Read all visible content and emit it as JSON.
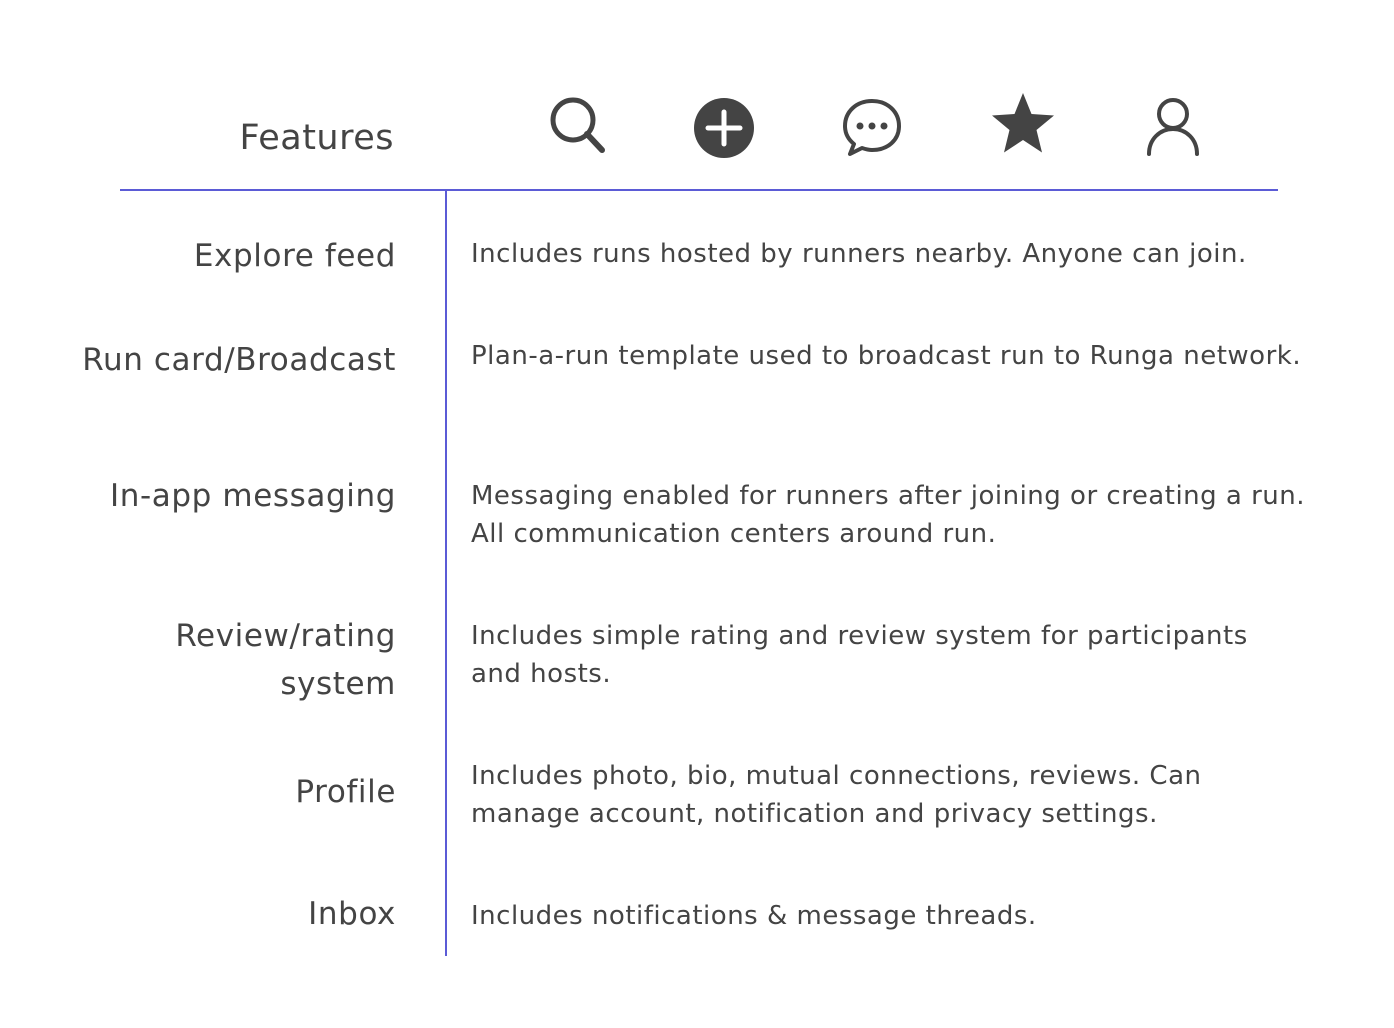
{
  "header": {
    "label": "Features",
    "icons": [
      "search-icon",
      "add-circle-icon",
      "chat-bubble-icon",
      "star-icon",
      "profile-icon"
    ]
  },
  "colors": {
    "rule": "#5b5bd6",
    "text": "#444444",
    "icon": "#444444"
  },
  "features": [
    {
      "name": "Explore feed",
      "description": "Includes runs hosted by runners nearby. Anyone can join."
    },
    {
      "name": "Run card/Broadcast",
      "description": "Plan-a-run template used to broadcast run to Runga network."
    },
    {
      "name": "In-app messaging",
      "description": "Messaging enabled for runners after joining or creating a run. All communication centers around run."
    },
    {
      "name": "Review/rating\nsystem",
      "description": "Includes simple rating and review system for participants and hosts."
    },
    {
      "name": "Profile",
      "description": "Includes photo, bio, mutual connections, reviews. Can manage account, notification and privacy settings."
    },
    {
      "name": "Inbox",
      "description": "Includes notifications & message threads."
    }
  ]
}
